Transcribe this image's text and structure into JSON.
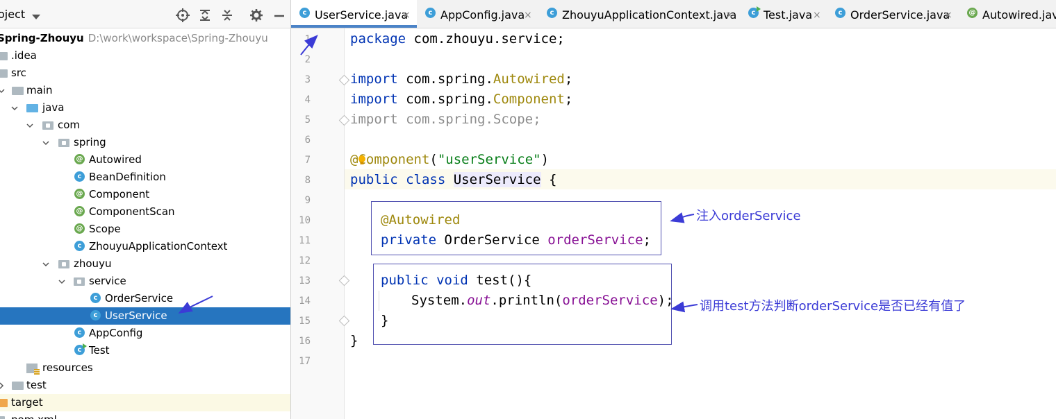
{
  "project_panel": {
    "title": "oject",
    "tree": [
      {
        "label": "Spring-Zhouyu",
        "path": "D:\\work\\workspace\\Spring-Zhouyu"
      },
      {
        "label": ".idea"
      },
      {
        "label": "src"
      },
      {
        "label": "main"
      },
      {
        "label": "java"
      },
      {
        "label": "com"
      },
      {
        "label": "spring"
      },
      {
        "label": "Autowired"
      },
      {
        "label": "BeanDefinition"
      },
      {
        "label": "Component"
      },
      {
        "label": "ComponentScan"
      },
      {
        "label": "Scope"
      },
      {
        "label": "ZhouyuApplicationContext"
      },
      {
        "label": "zhouyu"
      },
      {
        "label": "service"
      },
      {
        "label": "OrderService"
      },
      {
        "label": "UserService"
      },
      {
        "label": "AppConfig"
      },
      {
        "label": "Test"
      },
      {
        "label": "resources"
      },
      {
        "label": "test"
      },
      {
        "label": "target"
      },
      {
        "label": "pom.xml"
      }
    ]
  },
  "tabs": [
    {
      "label": "UserService.java",
      "close": "×"
    },
    {
      "label": "AppConfig.java",
      "close": "×"
    },
    {
      "label": "ZhouyuApplicationContext.java",
      "close": "×"
    },
    {
      "label": "Test.java",
      "close": "×"
    },
    {
      "label": "OrderService.java",
      "close": "×"
    },
    {
      "label": "Autowired.java"
    }
  ],
  "editor": {
    "line_numbers": [
      "1",
      "2",
      "3",
      "4",
      "5",
      "6",
      "7",
      "8",
      "9",
      "10",
      "11",
      "12",
      "13",
      "14",
      "15",
      "16",
      "17"
    ],
    "code": {
      "l1_kw": "package",
      "l1_rest": " com.zhouyu.service;",
      "l3_kw": "import",
      "l3_a": " com.spring.",
      "l3_b": "Autowired",
      "l3_c": ";",
      "l4_kw": "import",
      "l4_a": " com.spring.",
      "l4_b": "Component",
      "l4_c": ";",
      "l5": "import com.spring.Scope;",
      "l7_a": "@",
      "l7_b": "Component",
      "l7_c": "(",
      "l7_d": "\"userService\"",
      "l7_e": ")",
      "l8_a": "public class",
      "l8_b": " ",
      "l8_c": "UserService",
      "l8_d": " {",
      "l10": "@Autowired",
      "l11_a": "private",
      "l11_b": " OrderService ",
      "l11_c": "orderService",
      "l11_d": ";",
      "l13_a": "public void",
      "l13_b": " test(){",
      "l14_a": "System.",
      "l14_b": "out",
      "l14_c": ".println(",
      "l14_d": "orderService",
      "l14_e": ");",
      "l15": "}",
      "l16": "}"
    },
    "annotations": {
      "note1": "注入orderService",
      "note2": "调用test方法判断orderService是否已经有值了"
    }
  },
  "colors": {
    "keyword": "#0033b3",
    "annotation": "#9e880d",
    "string": "#067d17",
    "field": "#871094",
    "selection": "#2675bf",
    "note": "#3b3bd6"
  }
}
